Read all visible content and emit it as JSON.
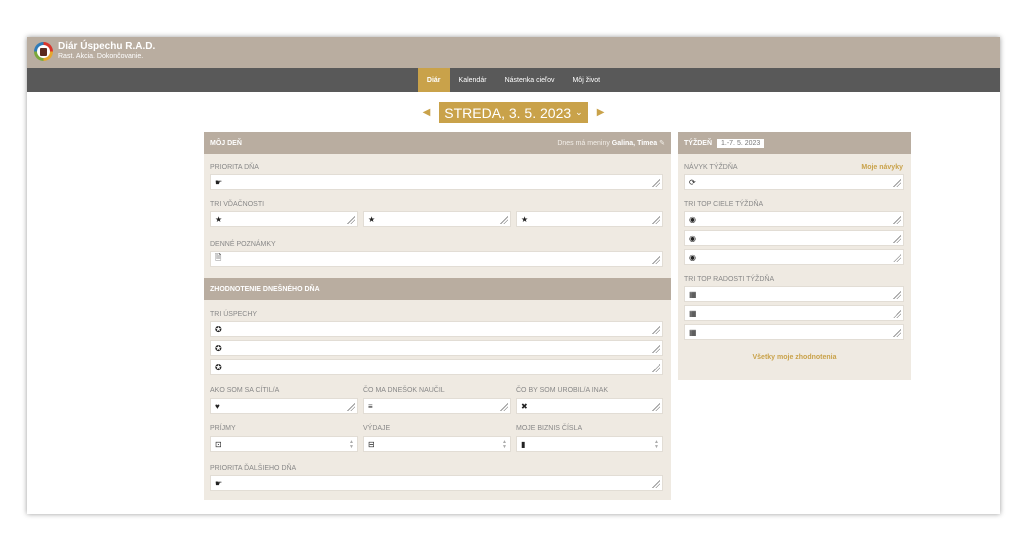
{
  "app": {
    "title": "Diár Úspechu R.A.D.",
    "subtitle": "Rast. Akcia. Dokončovanie."
  },
  "nav": {
    "items": [
      "Diár",
      "Kalendár",
      "Nástenka cieľov",
      "Môj život"
    ]
  },
  "date": {
    "label": "STREDA, 3. 5. 2023",
    "chevron": "⌄",
    "prev": "◀",
    "next": "▶"
  },
  "day": {
    "title": "MÔJ DEŇ",
    "nameday_prefix": "Dnes má meniny ",
    "nameday_names": "Galina, Timea",
    "priority_label": "PRIORITA DŇA",
    "gratitude_label": "TRI VĎAČNOSTI",
    "notes_label": "DENNÉ POZNÁMKY"
  },
  "review": {
    "title": "ZHODNOTENIE DNEŠNÉHO DŇA",
    "successes_label": "TRI ÚSPECHY",
    "feel_label": "AKO SOM SA CÍTIL/A",
    "learned_label": "ČO MA DNEŠOK NAUČIL",
    "differently_label": "ČO BY SOM UROBIL/A INAK",
    "income_label": "PRÍJMY",
    "expenses_label": "VÝDAJE",
    "business_label": "MOJE BIZNIS ČÍSLA",
    "next_priority_label": "PRIORITA ĎALŠIEHO DŇA"
  },
  "week": {
    "title": "TÝŽDEŇ",
    "range": "1.-7. 5. 2023",
    "habit_label": "NÁVYK TÝŽDŇA",
    "habits_link": "Moje návyky",
    "goals_label": "TRI TOP CIELE TÝŽDŇA",
    "joys_label": "TRI TOP RADOSTI TÝŽDŇA",
    "all_reviews_link": "Všetky moje zhodnotenia"
  },
  "icons": {
    "priority": "☛",
    "star": "★",
    "note": "🗎",
    "badge": "✪",
    "heart": "♥",
    "cap": "≡",
    "cross": "✖",
    "income": "⊡",
    "expense": "⊟",
    "chart": "▮",
    "refresh": "⟳",
    "target": "◉",
    "gift": "▦"
  }
}
